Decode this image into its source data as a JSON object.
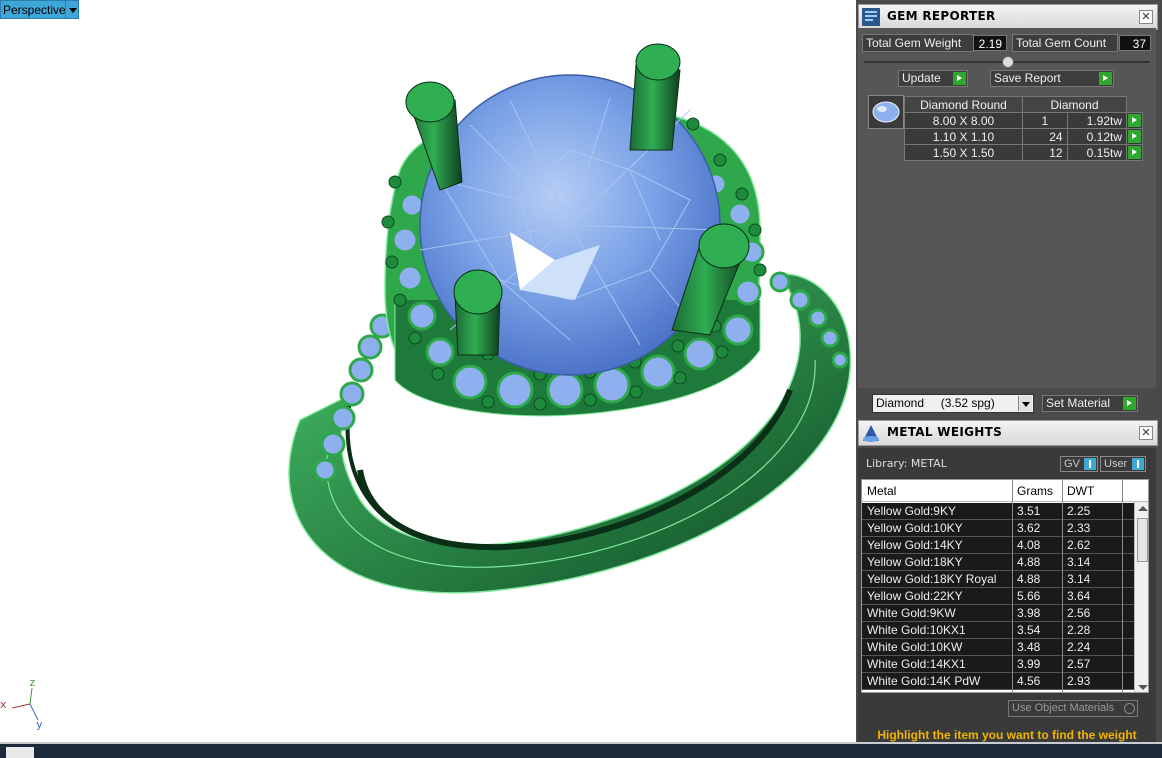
{
  "viewport": {
    "view_name": "Perspective",
    "axes": {
      "x": "x",
      "y": "y",
      "z": "z"
    }
  },
  "gem_reporter": {
    "title": "GEM REPORTER",
    "total_weight_label": "Total Gem Weight",
    "total_weight_value": "2.19",
    "total_count_label": "Total Gem Count",
    "total_count_value": "37",
    "update_label": "Update",
    "save_label": "Save Report",
    "table": {
      "col1": "Diamond Round",
      "col2": "Diamond",
      "rows": [
        {
          "size": "8.00 X 8.00",
          "count": "1",
          "weight": "1.92tw"
        },
        {
          "size": "1.10 X 1.10",
          "count": "24",
          "weight": "0.12tw"
        },
        {
          "size": "1.50 X 1.50",
          "count": "12",
          "weight": "0.15tw"
        }
      ]
    },
    "material_select": "Diamond     (3.52 spg)",
    "set_material_label": "Set Material"
  },
  "metal_weights": {
    "title": "METAL WEIGHTS",
    "library_label": "Library: METAL",
    "gv_label": "GV",
    "user_label": "User",
    "headers": {
      "metal": "Metal",
      "grams": "Grams",
      "dwt": "DWT"
    },
    "rows": [
      {
        "metal": "Yellow Gold:9KY",
        "grams": "3.51",
        "dwt": "2.25"
      },
      {
        "metal": "Yellow Gold:10KY",
        "grams": "3.62",
        "dwt": "2.33"
      },
      {
        "metal": "Yellow Gold:14KY",
        "grams": "4.08",
        "dwt": "2.62"
      },
      {
        "metal": "Yellow Gold:18KY",
        "grams": "4.88",
        "dwt": "3.14"
      },
      {
        "metal": "Yellow Gold:18KY Royal",
        "grams": "4.88",
        "dwt": "3.14"
      },
      {
        "metal": "Yellow Gold:22KY",
        "grams": "5.66",
        "dwt": "3.64"
      },
      {
        "metal": "White Gold:9KW",
        "grams": "3.98",
        "dwt": "2.56"
      },
      {
        "metal": "White Gold:10KX1",
        "grams": "3.54",
        "dwt": "2.28"
      },
      {
        "metal": "White Gold:10KW",
        "grams": "3.48",
        "dwt": "2.24"
      },
      {
        "metal": "White Gold:14KX1",
        "grams": "3.99",
        "dwt": "2.57"
      },
      {
        "metal": "White Gold:14K PdW",
        "grams": "4.56",
        "dwt": "2.93"
      }
    ],
    "use_object_materials": "Use Object Materials",
    "hint": "Highlight the item you want to find the weight"
  },
  "colors": {
    "metal_green": "#2ea84a",
    "gem_blue": "#7ea6e8",
    "accent_blue": "#3fa6d8",
    "hint_yellow": "#f0b400"
  }
}
